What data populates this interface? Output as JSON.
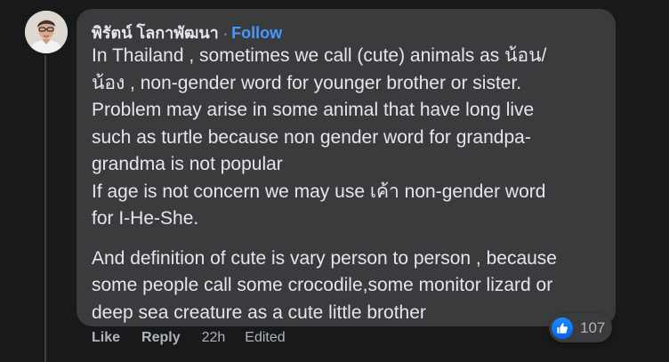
{
  "comment": {
    "author": "พิรัตน์ โลกาพัฒนา",
    "separator": "·",
    "follow_label": "Follow",
    "paragraphs": [
      {
        "lines": [
          "In Thailand , sometimes we call (cute) animals as น้อน/",
          "น้อง , non-gender word for younger brother or sister.",
          "Problem may arise in some animal that have long live",
          "such as turtle because non gender word for grandpa-",
          "grandma is not popular",
          "If age is not concern we may use เค้า non-gender word",
          "for I-He-She."
        ]
      },
      {
        "lines": [
          "And definition of cute is vary person to person , because",
          "some people call some crocodile,some monitor lizard or",
          "deep sea creature as a cute little brother"
        ]
      }
    ],
    "reaction_icon": "thumbs-up-icon",
    "reaction_count": "107",
    "actions": {
      "like_label": "Like",
      "reply_label": "Reply",
      "time": "22h",
      "edited": "Edited"
    }
  },
  "colors": {
    "background": "#18191a",
    "bubble": "#3a3b3c",
    "text": "#e4e6eb",
    "secondary_text": "#b0b3b8",
    "follow": "#4599ff",
    "like_blue": "#1877f2"
  }
}
